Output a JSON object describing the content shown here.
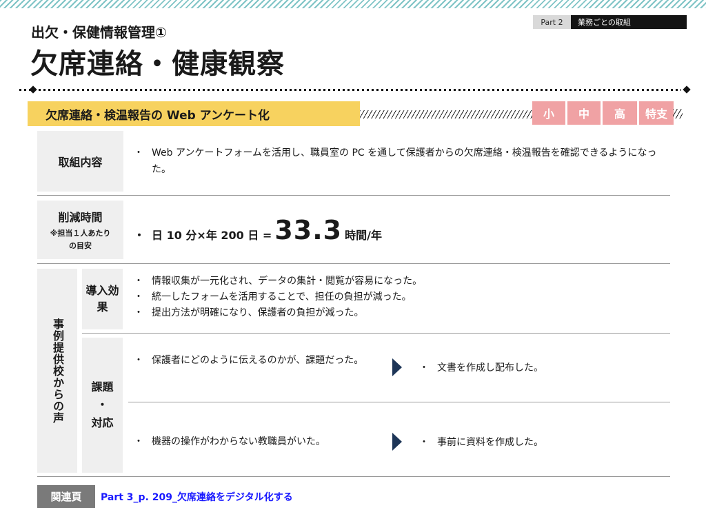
{
  "header": {
    "part": "Part 2",
    "category": "業務ごとの取組",
    "subtitle": "出欠・保健情報管理①",
    "title": "欠席連絡・健康観察"
  },
  "section": {
    "title": "欠席連絡・検温報告の Web アンケート化",
    "levels": [
      "小",
      "中",
      "高",
      "特支"
    ],
    "level_color": "#f0a2a4",
    "banner_color": "#f7d25f"
  },
  "content": {
    "label": "取組内容",
    "items": [
      "Web アンケートフォームを活用し、職員室の PC を通して保護者からの欠席連絡・検温報告を確認できるようになった。"
    ]
  },
  "time_saved": {
    "label": "削減時間",
    "note_line1": "※担当１人あたり",
    "note_line2": "の目安",
    "bullet": "・",
    "formula": "日 10 分×年 200 日 =",
    "value": "33.3",
    "unit": "時間/年"
  },
  "voices": {
    "label": "事例提供校からの声",
    "effect_label": "導入効果",
    "effects": [
      "情報収集が一元化され、データの集計・閲覧が容易になった。",
      "統一したフォームを活用することで、担任の負担が減った。",
      "提出方法が明確になり、保護者の負担が減った。"
    ],
    "issue_label_top": "課題",
    "issue_label_mid": "・",
    "issue_label_bottom": "対応",
    "issues": [
      {
        "issue": "保護者にどのように伝えるのかが、課題だった。",
        "response": "文書を作成し配布した。"
      },
      {
        "issue": "機器の操作がわからない教職員がいた。",
        "response": "事前に資料を作成した。"
      }
    ]
  },
  "related": {
    "label": "関連頁",
    "link": "Part 3_p. 209_欠席連絡をデジタル化する"
  }
}
